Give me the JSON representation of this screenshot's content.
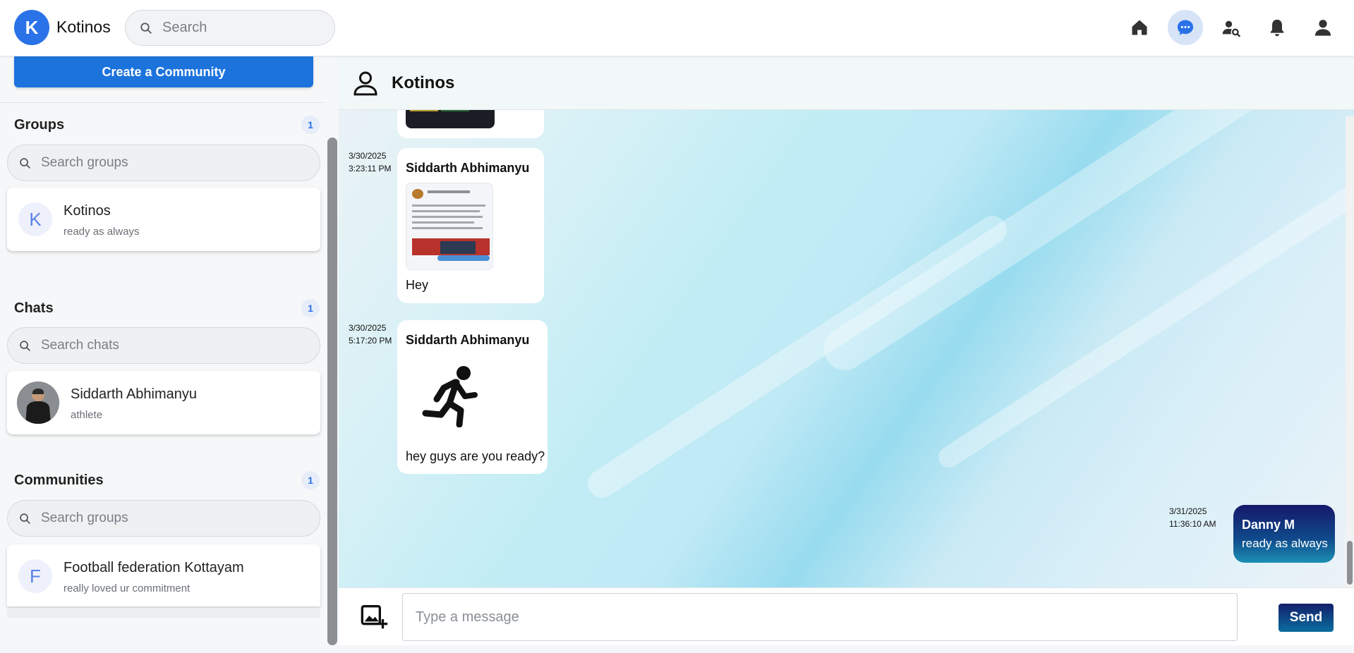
{
  "app": {
    "logo_letter": "K",
    "brand": "Kotinos"
  },
  "search": {
    "placeholder": "Search"
  },
  "nav": {
    "icons": [
      "home-icon",
      "messages-icon",
      "find-people-icon",
      "notifications-icon",
      "profile-icon"
    ],
    "active": "messages-icon",
    "accent": "#2a72e8"
  },
  "sidebar": {
    "create_label": "Create a Community",
    "groups": {
      "title": "Groups",
      "count": "1",
      "search_placeholder": "Search groups",
      "items": [
        {
          "letter": "K",
          "name": "Kotinos",
          "subtitle": "ready as always"
        }
      ]
    },
    "chats": {
      "title": "Chats",
      "count": "1",
      "search_placeholder": "Search chats",
      "items": [
        {
          "name": "Siddarth Abhimanyu",
          "subtitle": "athlete"
        }
      ]
    },
    "communities": {
      "title": "Communities",
      "count": "1",
      "search_placeholder": "Search groups",
      "items": [
        {
          "letter": "F",
          "name": "Football federation Kottayam",
          "subtitle": "really loved ur commitment"
        }
      ]
    }
  },
  "chat": {
    "title": "Kotinos",
    "messages": [
      {
        "date": "3/30/2025",
        "time": "3:23:11 PM",
        "sender": "Siddarth Abhimanyu",
        "text": "Hey",
        "attachment": "screenshot-image"
      },
      {
        "date": "3/30/2025",
        "time": "5:17:20 PM",
        "sender": "Siddarth Abhimanyu",
        "text": "hey guys are you ready?",
        "attachment": "running-figure-icon"
      },
      {
        "date": "3/31/2025",
        "time": "11:36:10 AM",
        "sender": "Danny M",
        "text": "ready as always",
        "own": true
      }
    ]
  },
  "composer": {
    "placeholder": "Type a message",
    "send_label": "Send"
  }
}
